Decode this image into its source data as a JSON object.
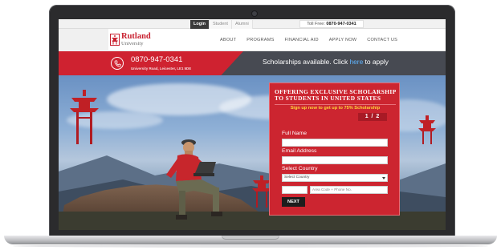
{
  "topbar": {
    "tabs": [
      {
        "label": "Login",
        "active": true
      },
      {
        "label": "Student",
        "active": false
      },
      {
        "label": "Alumni",
        "active": false
      }
    ],
    "tollfree_label": "Toll Free:",
    "tollfree_number": "0870-947-0341"
  },
  "logo": {
    "name": "Rutland",
    "sub": "University"
  },
  "nav": {
    "items": [
      "ABOUT",
      "PROGRAMS",
      "FINANCIAL AID",
      "APPLY NOW",
      "CONTACT US"
    ]
  },
  "info": {
    "phone": "0870-947-0341",
    "address": "University Road, Leicester, LE1 5DE",
    "scholar_prefix": "Scholarships available. Click",
    "scholar_link": "here",
    "scholar_suffix": "to apply"
  },
  "form": {
    "title": "OFFERING EXCLUSIVE SCHOLARSHIP TO STUDENTS IN UNITED STATES",
    "subtitle": "Sign up now to get up to 75% Scholarship",
    "step": "1 / 2",
    "name_label": "Full Name",
    "name_value": "",
    "email_label": "Email Address",
    "email_value": "",
    "country_label": "Select Country",
    "country_selected": "Select Country",
    "code_value": "",
    "phone_placeholder": "Area Code + Phone No.",
    "next_label": "NEXT"
  },
  "colors": {
    "brand_red": "#cc2530",
    "dark_strip": "#474a52",
    "link_blue": "#5fb4ff",
    "accent_yellow": "#ffd53a"
  },
  "icons": [
    "phone-icon",
    "pagoda-logo-icon",
    "chevron-down-icon"
  ]
}
